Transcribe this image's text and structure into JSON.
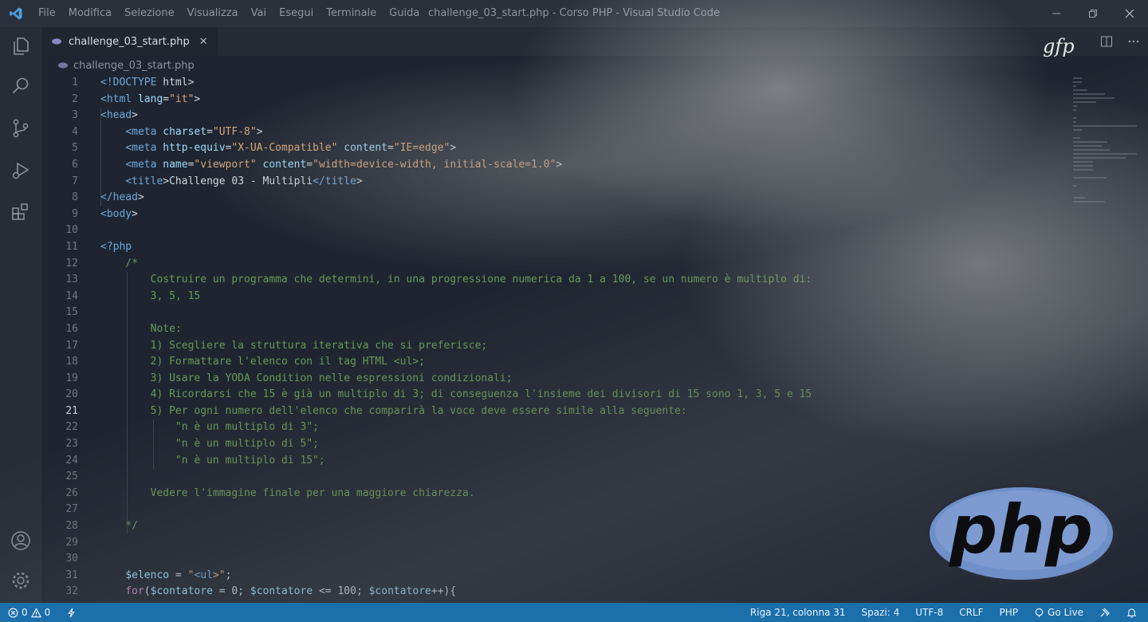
{
  "window": {
    "title": "challenge_03_start.php - Corso PHP - Visual Studio Code",
    "menu": [
      "File",
      "Modifica",
      "Selezione",
      "Visualizza",
      "Vai",
      "Esegui",
      "Terminale",
      "Guida"
    ]
  },
  "tab": {
    "label": "challenge_03_start.php",
    "close_glyph": "✕"
  },
  "breadcrumb": {
    "file": "challenge_03_start.php"
  },
  "editor": {
    "active_line": 21,
    "lines": [
      {
        "n": "1",
        "t": "<!DOCTYPE html>"
      },
      {
        "n": "2",
        "t": "<html lang=\"it\">"
      },
      {
        "n": "3",
        "t": "<head>"
      },
      {
        "n": "4",
        "t": "    <meta charset=\"UTF-8\">"
      },
      {
        "n": "5",
        "t": "    <meta http-equiv=\"X-UA-Compatible\" content=\"IE=edge\">"
      },
      {
        "n": "6",
        "t": "    <meta name=\"viewport\" content=\"width=device-width, initial-scale=1.0\">"
      },
      {
        "n": "7",
        "t": "    <title>Challenge 03 - Multipli</title>"
      },
      {
        "n": "8",
        "t": "</head>"
      },
      {
        "n": "9",
        "t": "<body>"
      },
      {
        "n": "10",
        "t": ""
      },
      {
        "n": "11",
        "t": "<?php"
      },
      {
        "n": "12",
        "t": "    /*"
      },
      {
        "n": "13",
        "t": "        Costruire un programma che determini, in una progressione numerica da 1 a 100, se un numero è multiplo di:"
      },
      {
        "n": "14",
        "t": "        3, 5, 15"
      },
      {
        "n": "15",
        "t": ""
      },
      {
        "n": "16",
        "t": "        Note:"
      },
      {
        "n": "17",
        "t": "        1) Scegliere la struttura iterativa che si preferisce;"
      },
      {
        "n": "18",
        "t": "        2) Formattare l'elenco con il tag HTML <ul>;"
      },
      {
        "n": "19",
        "t": "        3) Usare la YODA Condition nelle espressioni condizionali;"
      },
      {
        "n": "20",
        "t": "        4) Ricordarsi che 15 è già un multiplo di 3; di conseguenza l'insieme dei divisori di 15 sono 1, 3, 5 e 15"
      },
      {
        "n": "21",
        "t": "        5) Per ogni numero dell'elenco che comparirà la voce deve essere simile alla seguente:"
      },
      {
        "n": "22",
        "t": "            \"n è un multiplo di 3\";"
      },
      {
        "n": "23",
        "t": "            \"n è un multiplo di 5\";"
      },
      {
        "n": "24",
        "t": "            \"n è un multiplo di 15\";"
      },
      {
        "n": "25",
        "t": ""
      },
      {
        "n": "26",
        "t": "        Vedere l'immagine finale per una maggiore chiarezza."
      },
      {
        "n": "27",
        "t": ""
      },
      {
        "n": "28",
        "t": "    */"
      },
      {
        "n": "29",
        "t": ""
      },
      {
        "n": "30",
        "t": ""
      },
      {
        "n": "31",
        "t": "    $elenco = \"<ul>\";"
      },
      {
        "n": "32",
        "t": "    for($contatore = 0; $contatore <= 100; $contatore++){"
      }
    ]
  },
  "statusbar": {
    "errors": "0",
    "warnings": "0",
    "position": "Riga 21, colonna 31",
    "spaces": "Spazi: 4",
    "encoding": "UTF-8",
    "eol": "CRLF",
    "language": "PHP",
    "golive": "Go Live"
  },
  "brand": {
    "gfp": "gfp",
    "php": "php"
  },
  "colors": {
    "statusbar": "#1b6fab",
    "php_logo": "#6f8fc8"
  }
}
